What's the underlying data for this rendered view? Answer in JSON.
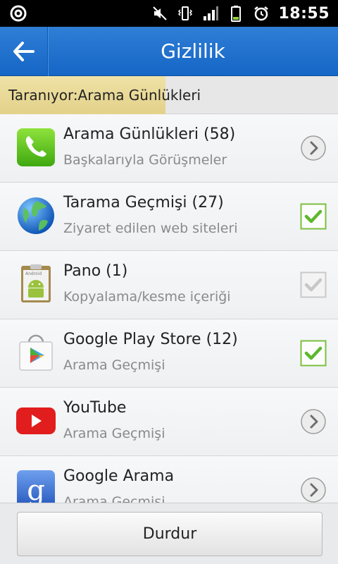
{
  "status_bar": {
    "time": "18:55",
    "icons": [
      "app-notification-icon",
      "mute-icon",
      "vibrate-icon",
      "signal-icon",
      "battery-icon",
      "alarm-icon"
    ]
  },
  "header": {
    "title": "Gizlilik",
    "back_icon": "back-arrow-icon"
  },
  "scan": {
    "text": "Taranıyor:Arama Günlükleri",
    "progress": 0.49
  },
  "items": [
    {
      "title": "Arama Günlükleri (58)",
      "subtitle": "Başkalarıyla Görüşmeler",
      "icon": "phone-icon",
      "action": "chevron"
    },
    {
      "title": "Tarama Geçmişi (27)",
      "subtitle": "Ziyaret edilen web siteleri",
      "icon": "globe-icon",
      "action": "checked"
    },
    {
      "title": "Pano (1)",
      "subtitle": "Kopyalama/kesme içeriği",
      "icon": "android-clipboard-icon",
      "action": "checked-disabled"
    },
    {
      "title": "Google Play Store (12)",
      "subtitle": "Arama Geçmişi",
      "icon": "play-store-icon",
      "action": "checked"
    },
    {
      "title": "YouTube",
      "subtitle": "Arama Geçmişi",
      "icon": "youtube-icon",
      "action": "chevron"
    },
    {
      "title": "Google Arama",
      "subtitle": "Arama Geçmişi",
      "icon": "google-search-icon",
      "action": "chevron"
    }
  ],
  "footer": {
    "stop_label": "Durdur"
  },
  "colors": {
    "accent": "#1a6fcc",
    "check_green": "#5cb82c",
    "progress": "#e8d893"
  }
}
